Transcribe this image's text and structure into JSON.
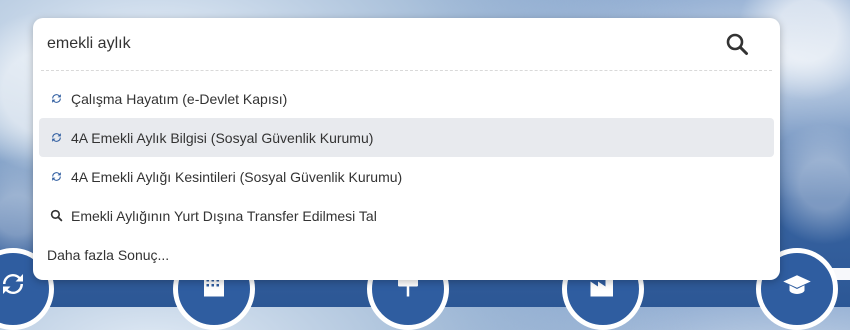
{
  "search": {
    "value": "emekli aylık",
    "placeholder": ""
  },
  "results": [
    {
      "icon": "refresh-icon",
      "label": "Çalışma Hayatım (e-Devlet Kapısı)",
      "active": false
    },
    {
      "icon": "refresh-icon",
      "label": "4A Emekli Aylık Bilgisi (Sosyal Güvenlik Kurumu)",
      "active": true
    },
    {
      "icon": "refresh-icon",
      "label": "4A Emekli Aylığı Kesintileri (Sosyal Güvenlik Kurumu)",
      "active": false
    },
    {
      "icon": "search-icon",
      "label": "Emekli Aylığının Yurt Dışına Transfer Edilmesi Tal",
      "active": false
    }
  ],
  "more_label": "Daha fazla Sonuç...",
  "bottom_icons": [
    "refresh-icon",
    "building-icon",
    "signpost-icon",
    "factory-icon",
    "graduation-cap-icon"
  ],
  "colors": {
    "accent": "#2f5da0",
    "active_row": "#e8eaee",
    "text": "#333333"
  }
}
